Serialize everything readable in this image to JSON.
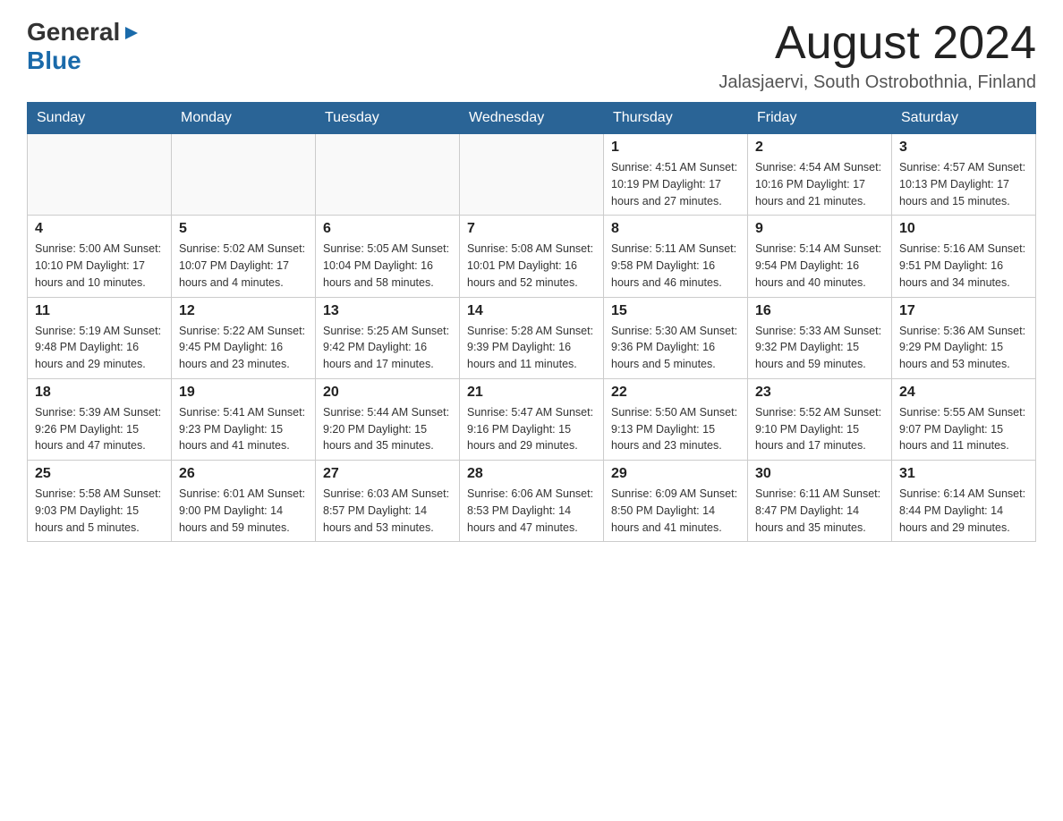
{
  "header": {
    "logo_general": "General",
    "logo_blue": "Blue",
    "month_title": "August 2024",
    "location": "Jalasjaervi, South Ostrobothnia, Finland"
  },
  "days_of_week": [
    "Sunday",
    "Monday",
    "Tuesday",
    "Wednesday",
    "Thursday",
    "Friday",
    "Saturday"
  ],
  "weeks": [
    [
      {
        "num": "",
        "info": ""
      },
      {
        "num": "",
        "info": ""
      },
      {
        "num": "",
        "info": ""
      },
      {
        "num": "",
        "info": ""
      },
      {
        "num": "1",
        "info": "Sunrise: 4:51 AM\nSunset: 10:19 PM\nDaylight: 17 hours\nand 27 minutes."
      },
      {
        "num": "2",
        "info": "Sunrise: 4:54 AM\nSunset: 10:16 PM\nDaylight: 17 hours\nand 21 minutes."
      },
      {
        "num": "3",
        "info": "Sunrise: 4:57 AM\nSunset: 10:13 PM\nDaylight: 17 hours\nand 15 minutes."
      }
    ],
    [
      {
        "num": "4",
        "info": "Sunrise: 5:00 AM\nSunset: 10:10 PM\nDaylight: 17 hours\nand 10 minutes."
      },
      {
        "num": "5",
        "info": "Sunrise: 5:02 AM\nSunset: 10:07 PM\nDaylight: 17 hours\nand 4 minutes."
      },
      {
        "num": "6",
        "info": "Sunrise: 5:05 AM\nSunset: 10:04 PM\nDaylight: 16 hours\nand 58 minutes."
      },
      {
        "num": "7",
        "info": "Sunrise: 5:08 AM\nSunset: 10:01 PM\nDaylight: 16 hours\nand 52 minutes."
      },
      {
        "num": "8",
        "info": "Sunrise: 5:11 AM\nSunset: 9:58 PM\nDaylight: 16 hours\nand 46 minutes."
      },
      {
        "num": "9",
        "info": "Sunrise: 5:14 AM\nSunset: 9:54 PM\nDaylight: 16 hours\nand 40 minutes."
      },
      {
        "num": "10",
        "info": "Sunrise: 5:16 AM\nSunset: 9:51 PM\nDaylight: 16 hours\nand 34 minutes."
      }
    ],
    [
      {
        "num": "11",
        "info": "Sunrise: 5:19 AM\nSunset: 9:48 PM\nDaylight: 16 hours\nand 29 minutes."
      },
      {
        "num": "12",
        "info": "Sunrise: 5:22 AM\nSunset: 9:45 PM\nDaylight: 16 hours\nand 23 minutes."
      },
      {
        "num": "13",
        "info": "Sunrise: 5:25 AM\nSunset: 9:42 PM\nDaylight: 16 hours\nand 17 minutes."
      },
      {
        "num": "14",
        "info": "Sunrise: 5:28 AM\nSunset: 9:39 PM\nDaylight: 16 hours\nand 11 minutes."
      },
      {
        "num": "15",
        "info": "Sunrise: 5:30 AM\nSunset: 9:36 PM\nDaylight: 16 hours\nand 5 minutes."
      },
      {
        "num": "16",
        "info": "Sunrise: 5:33 AM\nSunset: 9:32 PM\nDaylight: 15 hours\nand 59 minutes."
      },
      {
        "num": "17",
        "info": "Sunrise: 5:36 AM\nSunset: 9:29 PM\nDaylight: 15 hours\nand 53 minutes."
      }
    ],
    [
      {
        "num": "18",
        "info": "Sunrise: 5:39 AM\nSunset: 9:26 PM\nDaylight: 15 hours\nand 47 minutes."
      },
      {
        "num": "19",
        "info": "Sunrise: 5:41 AM\nSunset: 9:23 PM\nDaylight: 15 hours\nand 41 minutes."
      },
      {
        "num": "20",
        "info": "Sunrise: 5:44 AM\nSunset: 9:20 PM\nDaylight: 15 hours\nand 35 minutes."
      },
      {
        "num": "21",
        "info": "Sunrise: 5:47 AM\nSunset: 9:16 PM\nDaylight: 15 hours\nand 29 minutes."
      },
      {
        "num": "22",
        "info": "Sunrise: 5:50 AM\nSunset: 9:13 PM\nDaylight: 15 hours\nand 23 minutes."
      },
      {
        "num": "23",
        "info": "Sunrise: 5:52 AM\nSunset: 9:10 PM\nDaylight: 15 hours\nand 17 minutes."
      },
      {
        "num": "24",
        "info": "Sunrise: 5:55 AM\nSunset: 9:07 PM\nDaylight: 15 hours\nand 11 minutes."
      }
    ],
    [
      {
        "num": "25",
        "info": "Sunrise: 5:58 AM\nSunset: 9:03 PM\nDaylight: 15 hours\nand 5 minutes."
      },
      {
        "num": "26",
        "info": "Sunrise: 6:01 AM\nSunset: 9:00 PM\nDaylight: 14 hours\nand 59 minutes."
      },
      {
        "num": "27",
        "info": "Sunrise: 6:03 AM\nSunset: 8:57 PM\nDaylight: 14 hours\nand 53 minutes."
      },
      {
        "num": "28",
        "info": "Sunrise: 6:06 AM\nSunset: 8:53 PM\nDaylight: 14 hours\nand 47 minutes."
      },
      {
        "num": "29",
        "info": "Sunrise: 6:09 AM\nSunset: 8:50 PM\nDaylight: 14 hours\nand 41 minutes."
      },
      {
        "num": "30",
        "info": "Sunrise: 6:11 AM\nSunset: 8:47 PM\nDaylight: 14 hours\nand 35 minutes."
      },
      {
        "num": "31",
        "info": "Sunrise: 6:14 AM\nSunset: 8:44 PM\nDaylight: 14 hours\nand 29 minutes."
      }
    ]
  ]
}
